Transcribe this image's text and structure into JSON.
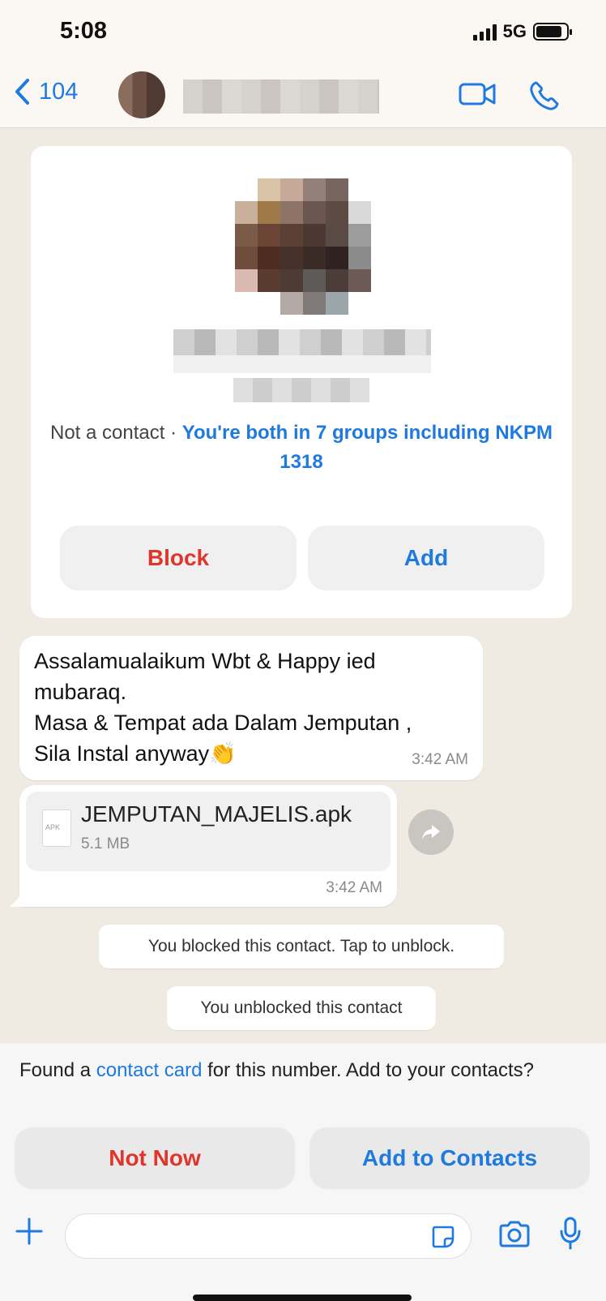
{
  "status": {
    "time": "5:08",
    "network": "5G",
    "battery_level": 0.85
  },
  "nav": {
    "back_count": "104"
  },
  "profile": {
    "not_contact": "Not a contact",
    "separator": "·",
    "groups_text": "You're both in 7 groups including NKPM 1318",
    "block_label": "Block",
    "add_label": "Add"
  },
  "messages": [
    {
      "text": "Assalamualaikum Wbt & Happy ied mubaraq.\nMasa & Tempat ada  Dalam Jemputan ,\nSila  Instal anyway👏",
      "time": "3:42 AM"
    },
    {
      "file_name": "JEMPUTAN_MAJELIS.apk",
      "file_type": "APK",
      "file_size": "5.1 MB",
      "time": "3:42 AM"
    }
  ],
  "system_messages": [
    "You blocked this contact. Tap to unblock.",
    "You unblocked this contact"
  ],
  "banner": {
    "text_before": "Found a ",
    "link_text": "contact card",
    "text_after": " for this number. Add to your contacts?",
    "not_now_label": "Not Now",
    "add_to_contacts_label": "Add to Contacts"
  },
  "icons": {
    "back": "chevron-left-icon",
    "video": "video-call-icon",
    "phone": "phone-icon",
    "forward": "forward-icon",
    "plus": "plus-icon",
    "sticker": "sticker-icon",
    "camera": "camera-icon",
    "mic": "microphone-icon"
  },
  "colors": {
    "accent": "#1f7ae0",
    "danger": "#e0352b",
    "chat_background": "#efeae2"
  }
}
